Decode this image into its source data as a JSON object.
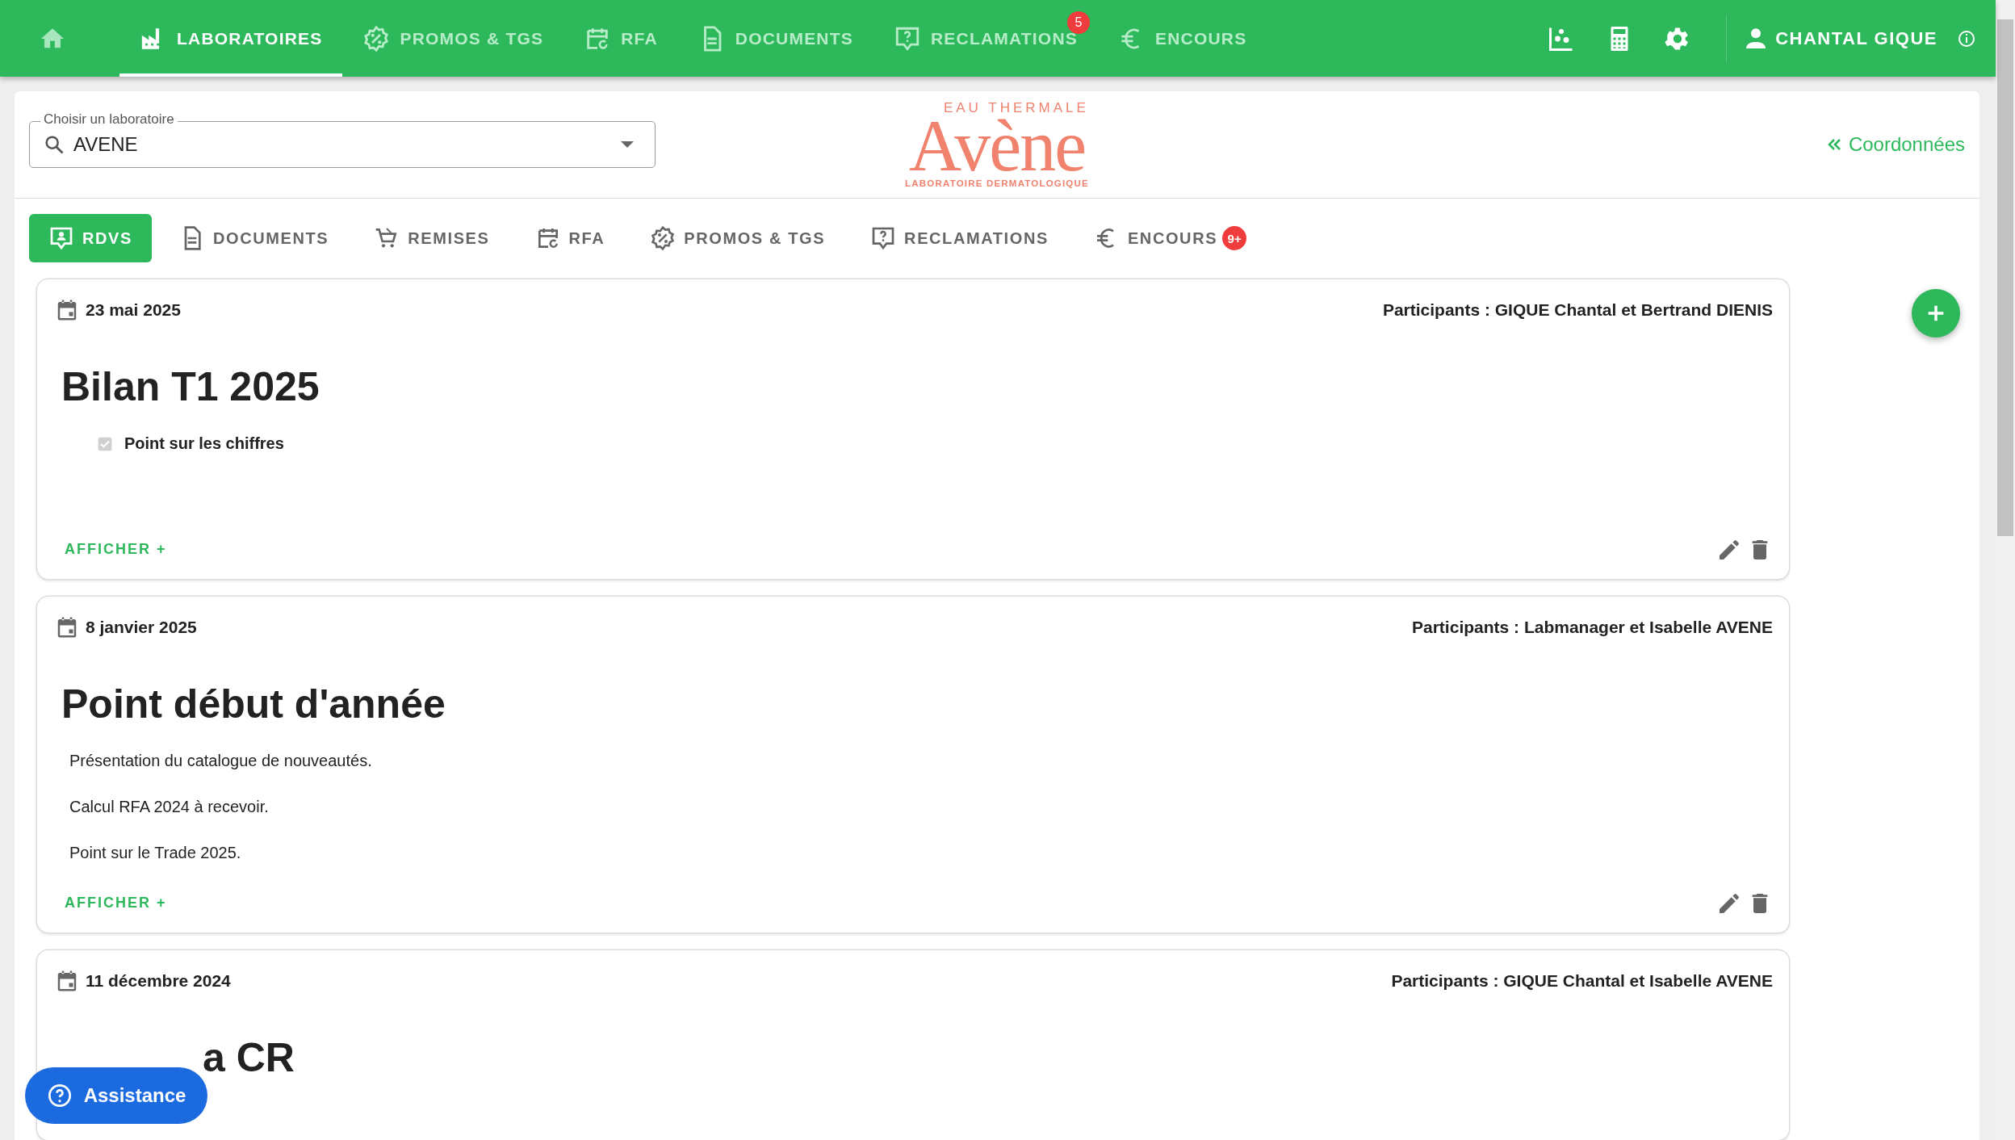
{
  "top_nav": {
    "items": [
      {
        "label": "LABORATOIRES",
        "selected": true
      },
      {
        "label": "PROMOS & TGS",
        "selected": false
      },
      {
        "label": "RFA",
        "selected": false
      },
      {
        "label": "DOCUMENTS",
        "selected": false
      },
      {
        "label": "RECLAMATIONS",
        "selected": false,
        "badge": "5"
      },
      {
        "label": "ENCOURS",
        "selected": false
      }
    ],
    "user": "CHANTAL GIQUE"
  },
  "lab_selector": {
    "label": "Choisir un laboratoire",
    "value": "AVENE"
  },
  "logo": {
    "top": "EAU THERMALE",
    "name": "Avène",
    "bottom": "LABORATOIRE DERMATOLOGIQUE"
  },
  "contact_link": "Coordonnées",
  "tabs": [
    {
      "label": "RDVS",
      "selected": true
    },
    {
      "label": "DOCUMENTS",
      "selected": false
    },
    {
      "label": "REMISES",
      "selected": false
    },
    {
      "label": "RFA",
      "selected": false
    },
    {
      "label": "PROMOS & TGS",
      "selected": false
    },
    {
      "label": "RECLAMATIONS",
      "selected": false
    },
    {
      "label": "ENCOURS",
      "selected": false,
      "badge": "9+"
    }
  ],
  "meetings": [
    {
      "date": "23 mai 2025",
      "participants": "Participants : GIQUE Chantal et Bertrand DIENIS",
      "title": "Bilan T1 2025",
      "content": [
        {
          "kind": "checkbox",
          "text": "Point sur les chiffres",
          "checked": true
        }
      ],
      "more": "AFFICHER +"
    },
    {
      "date": "8 janvier 2025",
      "participants": "Participants : Labmanager et Isabelle AVENE",
      "title": "Point début d'année",
      "content": [
        {
          "kind": "paragraph",
          "text": "Présentation du catalogue de nouveautés."
        },
        {
          "kind": "paragraph",
          "text": "Calcul RFA 2024 à recevoir."
        },
        {
          "kind": "paragraph",
          "text": "Point sur le Trade 2025."
        }
      ],
      "more": "AFFICHER +"
    },
    {
      "date": "11 décembre 2024",
      "participants": "Participants : GIQUE Chantal et Isabelle AVENE",
      "title": "a CR",
      "title_covered": true
    }
  ],
  "assistance": "Assistance"
}
